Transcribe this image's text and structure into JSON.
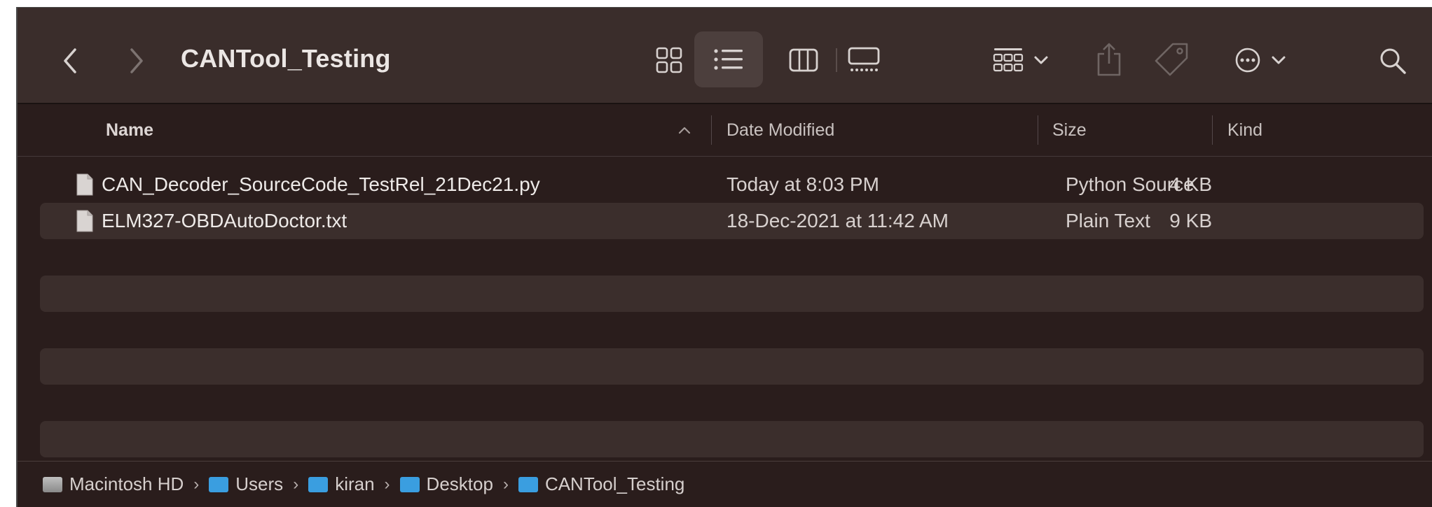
{
  "window": {
    "title": "CANTool_Testing"
  },
  "toolbar": {
    "back_icon": "chevron-left-icon",
    "forward_icon": "chevron-right-icon",
    "views": [
      "icon-view",
      "list-view",
      "column-view",
      "gallery-view"
    ],
    "selected_view": "list-view",
    "group_icon": "group-by-icon",
    "share_icon": "share-icon",
    "tag_icon": "tag-icon",
    "more_icon": "ellipsis-circle-icon",
    "search_icon": "search-icon"
  },
  "columns": {
    "name": "Name",
    "date": "Date Modified",
    "size": "Size",
    "kind": "Kind",
    "sort_indicator": "^"
  },
  "files": [
    {
      "name": "CAN_Decoder_SourceCode_TestRel_21Dec21.py",
      "date": "Today at 8:03 PM",
      "size": "4 KB",
      "kind": "Python Source"
    },
    {
      "name": "ELM327-OBDAutoDoctor.txt",
      "date": "18-Dec-2021 at 11:42 AM",
      "size": "9 KB",
      "kind": "Plain Text"
    }
  ],
  "path": [
    {
      "label": "Macintosh HD",
      "icon": "hard-drive-icon"
    },
    {
      "label": "Users",
      "icon": "folder-icon"
    },
    {
      "label": "kiran",
      "icon": "home-folder-icon"
    },
    {
      "label": "Desktop",
      "icon": "folder-icon"
    },
    {
      "label": "CANTool_Testing",
      "icon": "folder-icon"
    }
  ],
  "colors": {
    "window_bg": "#2a1d1c",
    "toolbar_bg": "#3a2d2b",
    "alt_row": "#3b2e2c",
    "folder_blue": "#3a9ee0"
  }
}
